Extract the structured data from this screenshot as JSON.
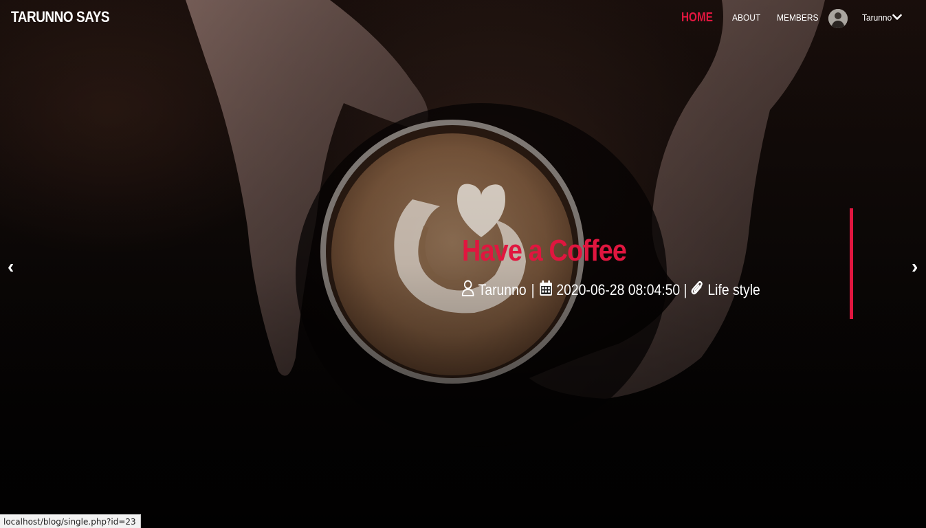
{
  "navbar": {
    "brand": "TARUNNO SAYS",
    "links": [
      {
        "label": "HOME",
        "active": true
      },
      {
        "label": "ABOUT",
        "active": false
      },
      {
        "label": "MEMBERS",
        "active": false
      }
    ],
    "user": {
      "name": "Tarunno",
      "avatar_icon": "user-avatar"
    }
  },
  "slide": {
    "title": "Have a Coffee",
    "author": "Tarunno",
    "date": "2020-06-28 08:04:50",
    "category": "Life style",
    "separator": "|",
    "prev_icon": "‹",
    "next_icon": "›"
  },
  "status_bar": {
    "url": "localhost/blog/single.php?id=23"
  },
  "colors": {
    "accent": "#e0163f",
    "text": "#ffffff"
  }
}
